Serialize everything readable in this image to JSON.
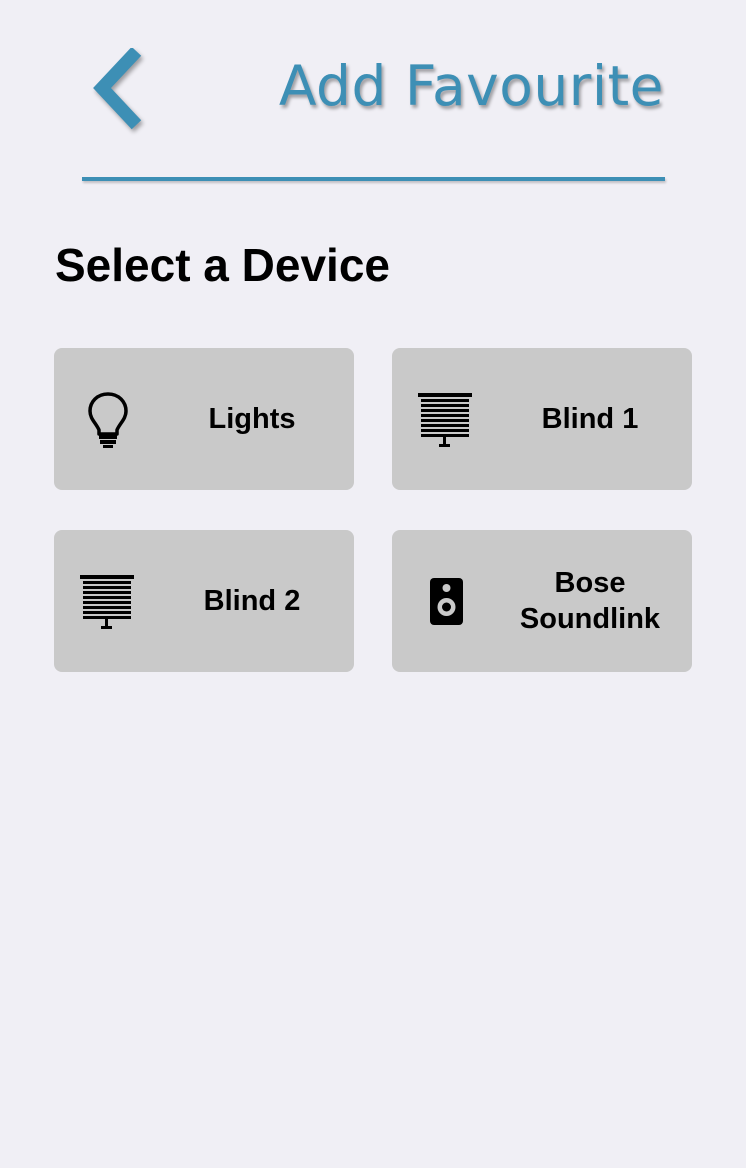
{
  "header": {
    "back_icon": "chevron-left-icon",
    "title": "Add Favourite",
    "accent_color": "#3d8fb5"
  },
  "section": {
    "heading": "Select a Device"
  },
  "devices": [
    {
      "label": "Lights",
      "icon": "lightbulb-icon"
    },
    {
      "label": "Blind 1",
      "icon": "blind-icon"
    },
    {
      "label": "Blind 2",
      "icon": "blind-icon"
    },
    {
      "label_line1": "Bose",
      "label_line2": "Soundlink",
      "icon": "speaker-icon"
    }
  ],
  "colors": {
    "background": "#f0eff5",
    "tile": "#c9c9c9",
    "text": "#000000"
  }
}
